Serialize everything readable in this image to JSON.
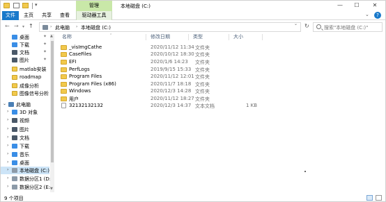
{
  "titlebar": {
    "manage_tab": "管理",
    "title": "本地磁盘 (C:)",
    "minimize": "—",
    "maximize": "☐",
    "close": "✕"
  },
  "ribbon": {
    "tabs": [
      "文件",
      "主页",
      "共享",
      "查看",
      "驱动器工具"
    ],
    "expand": "⌄",
    "help": "?"
  },
  "address": {
    "breadcrumbs": [
      "此电脑",
      "本地磁盘 (C:)"
    ],
    "search_placeholder": "搜索\"本地磁盘 (C:)\""
  },
  "sidebar": {
    "items": [
      {
        "label": "桌面",
        "icon": "desktop-icon",
        "pinned": true
      },
      {
        "label": "下载",
        "icon": "download-icon",
        "pinned": true
      },
      {
        "label": "文档",
        "icon": "documents-icon",
        "pinned": true
      },
      {
        "label": "图片",
        "icon": "pictures-icon",
        "pinned": true
      },
      {
        "label": "matlab安装",
        "icon": "folder-icon",
        "pinned": false
      },
      {
        "label": "roadmap",
        "icon": "folder-icon",
        "pinned": false
      },
      {
        "label": "成像分析",
        "icon": "folder-icon",
        "pinned": false
      },
      {
        "label": "图像信号分析",
        "icon": "folder-icon",
        "pinned": false
      },
      {
        "label": "此电脑",
        "icon": "this-pc-icon",
        "pinned": false
      },
      {
        "label": "3D 对象",
        "icon": "3d-objects-icon",
        "pinned": false
      },
      {
        "label": "视频",
        "icon": "videos-icon",
        "pinned": false
      },
      {
        "label": "图片",
        "icon": "pictures-icon",
        "pinned": false
      },
      {
        "label": "文档",
        "icon": "documents-icon",
        "pinned": false
      },
      {
        "label": "下载",
        "icon": "download-icon",
        "pinned": false
      },
      {
        "label": "音乐",
        "icon": "music-icon",
        "pinned": false
      },
      {
        "label": "桌面",
        "icon": "desktop-icon",
        "pinned": false
      },
      {
        "label": "本地磁盘 (C:)",
        "icon": "drive-icon",
        "pinned": false
      },
      {
        "label": "数据分区1 (D:)",
        "icon": "drive-icon",
        "pinned": false
      },
      {
        "label": "数据分区2 (E:)",
        "icon": "drive-icon",
        "pinned": false
      }
    ]
  },
  "columns": {
    "name": "名称",
    "date": "修改日期",
    "type": "类型",
    "size": "大小"
  },
  "files": [
    {
      "name": "_visImgCathe",
      "date": "2020/11/12 11:34",
      "type": "文件夹",
      "size": ""
    },
    {
      "name": "CaseFiles",
      "date": "2020/10/12 18:30",
      "type": "文件夹",
      "size": ""
    },
    {
      "name": "EFI",
      "date": "2020/1/6 14:23",
      "type": "文件夹",
      "size": ""
    },
    {
      "name": "PerfLogs",
      "date": "2019/9/15 15:33",
      "type": "文件夹",
      "size": ""
    },
    {
      "name": "Program Files",
      "date": "2020/11/12 12:01",
      "type": "文件夹",
      "size": ""
    },
    {
      "name": "Program Files (x86)",
      "date": "2020/11/7 18:18",
      "type": "文件夹",
      "size": ""
    },
    {
      "name": "Windows",
      "date": "2020/12/3 14:28",
      "type": "文件夹",
      "size": ""
    },
    {
      "name": "用户",
      "date": "2020/11/12 18:27",
      "type": "文件夹",
      "size": ""
    },
    {
      "name": "32132132132",
      "date": "2020/12/3 14:37",
      "type": "文本文档",
      "size": "1 KB"
    }
  ],
  "status": {
    "count": "9 个项目"
  }
}
